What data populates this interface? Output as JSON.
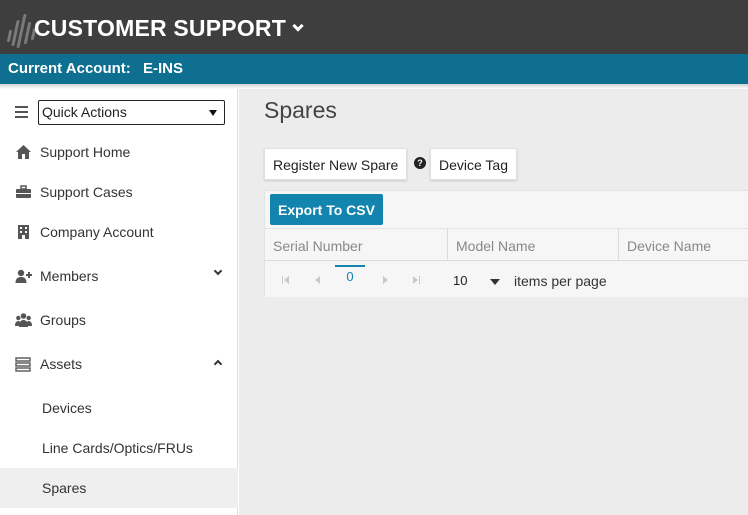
{
  "header": {
    "title": "CUSTOMER SUPPORT"
  },
  "account": {
    "label": "Current Account:",
    "value": "E-INS"
  },
  "sidebar": {
    "quick_actions": "Quick Actions",
    "items": [
      {
        "label": "Support Home",
        "icon": "home-icon"
      },
      {
        "label": "Support Cases",
        "icon": "briefcase-icon"
      },
      {
        "label": "Company Account",
        "icon": "building-icon"
      },
      {
        "label": "Members",
        "icon": "user-plus-icon",
        "expanded": false
      },
      {
        "label": "Groups",
        "icon": "users-icon"
      },
      {
        "label": "Assets",
        "icon": "server-icon",
        "expanded": true
      }
    ],
    "sub_items": [
      {
        "label": "Devices"
      },
      {
        "label": "Line Cards/Optics/FRUs"
      },
      {
        "label": "Spares",
        "active": true
      }
    ]
  },
  "main": {
    "title": "Spares",
    "register_button": "Register New Spare",
    "device_tag_button": "Device Tag",
    "help_glyph": "?",
    "export_button": "Export To CSV",
    "columns": [
      "Serial Number",
      "Model Name",
      "Device Name"
    ],
    "pager": {
      "current_page": "0",
      "page_size": "10",
      "page_size_label": "items per page"
    }
  },
  "colors": {
    "header_bg": "#3e3e3e",
    "account_bar_bg": "#0f6f90",
    "accent": "#1384ad",
    "content_bg": "#ececec"
  }
}
